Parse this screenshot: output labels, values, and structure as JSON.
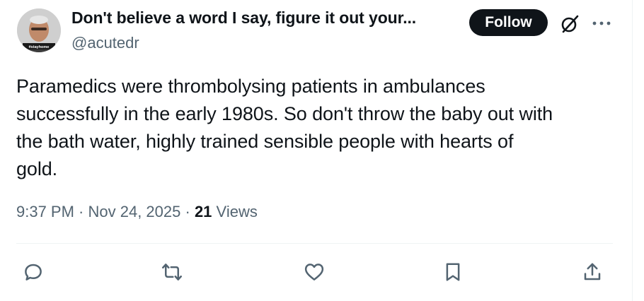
{
  "author": {
    "display_name": "Don't believe a word I say, figure it out your...",
    "handle": "@acutedr",
    "avatar_badge": "#stayhome"
  },
  "header": {
    "follow_label": "Follow"
  },
  "tweet": {
    "text": "Paramedics were thrombolysing patients in ambulances\nsuccessfully in the early 1980s. So don't throw the baby out with\nthe bath water, highly trained sensible people with hearts of\ngold.",
    "time": "9:37 PM",
    "date": "Nov 24, 2025",
    "views_count": "21",
    "views_label": "Views"
  },
  "actions": {
    "icons": [
      "reply-icon",
      "retweet-icon",
      "like-icon",
      "bookmark-icon",
      "share-icon"
    ]
  },
  "colors": {
    "text_primary": "#0f1419",
    "text_secondary": "#536471",
    "follow_bg": "#0f1419",
    "divider": "#eff3f4"
  }
}
